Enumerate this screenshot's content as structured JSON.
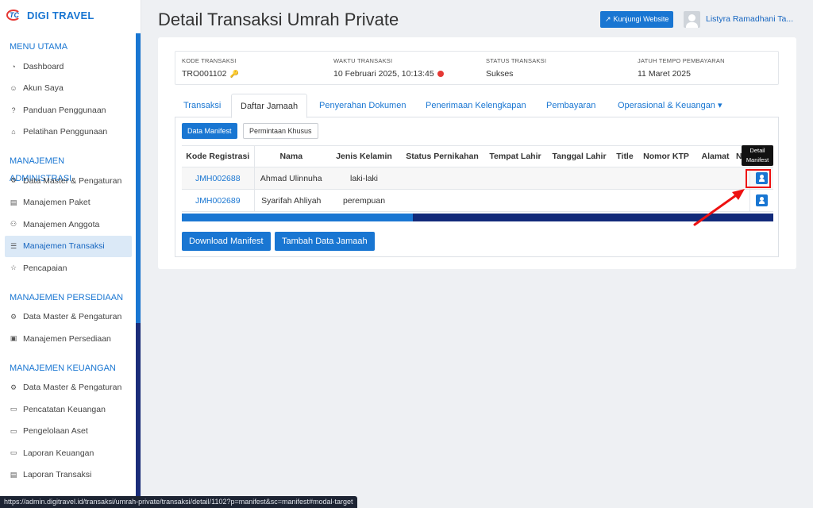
{
  "brand": {
    "name": "DIGI TRAVEL",
    "logo_text": "TC"
  },
  "sidebar": {
    "sections": [
      {
        "title": "MENU UTAMA",
        "items": [
          {
            "label": "Dashboard",
            "icon": "dashboard-icon"
          },
          {
            "label": "Akun Saya",
            "icon": "user-icon"
          },
          {
            "label": "Panduan Penggunaan",
            "icon": "question-icon"
          },
          {
            "label": "Pelatihan Penggunaan",
            "icon": "graduation-cap-icon"
          }
        ]
      },
      {
        "title": "MANAJEMEN ADMINISTRASI",
        "items": [
          {
            "label": "Data Master & Pengaturan",
            "icon": "cogs-icon"
          },
          {
            "label": "Manajemen Paket",
            "icon": "book-icon"
          },
          {
            "label": "Manajemen Anggota",
            "icon": "users-icon"
          },
          {
            "label": "Manajemen Transaksi",
            "icon": "cart-icon",
            "active": true
          },
          {
            "label": "Pencapaian",
            "icon": "star-icon"
          }
        ]
      },
      {
        "title": "MANAJEMEN PERSEDIAAN",
        "items": [
          {
            "label": "Data Master & Pengaturan",
            "icon": "cogs-icon"
          },
          {
            "label": "Manajemen Persediaan",
            "icon": "cubes-icon"
          }
        ]
      },
      {
        "title": "MANAJEMEN KEUANGAN",
        "items": [
          {
            "label": "Data Master & Pengaturan",
            "icon": "cogs-icon"
          },
          {
            "label": "Pencatatan Keuangan",
            "icon": "money-icon"
          },
          {
            "label": "Pengelolaan Aset",
            "icon": "inbox-icon"
          },
          {
            "label": "Laporan Keuangan",
            "icon": "money-icon"
          },
          {
            "label": "Laporan Transaksi",
            "icon": "book-icon"
          }
        ]
      }
    ]
  },
  "header": {
    "title": "Detail Transaksi Umrah Private",
    "visit_button": "Kunjungi Website",
    "username": "Listyra Ramadhani Ta..."
  },
  "info": {
    "code_label": "KODE TRANSAKSI",
    "code_value": "TRO001102",
    "time_label": "WAKTU TRANSAKSI",
    "time_value": "10 Februari 2025, 10:13:45",
    "status_label": "STATUS TRANSAKSI",
    "status_value": "Sukses",
    "due_label": "JATUH TEMPO PEMBAYARAN",
    "due_value": "11 Maret 2025"
  },
  "tabs": [
    "Transaksi",
    "Daftar Jamaah",
    "Penyerahan Dokumen",
    "Penerimaan Kelengkapan",
    "Pembayaran",
    "Operasional & Keuangan"
  ],
  "subtabs": {
    "manifest": "Data Manifest",
    "special": "Permintaan Khusus"
  },
  "table": {
    "headers": [
      "Kode Registrasi",
      "Nama",
      "Jenis Kelamin",
      "Status Pernikahan",
      "Tempat Lahir",
      "Tanggal Lahir",
      "Title",
      "Nomor KTP",
      "Alamat",
      "No"
    ],
    "rows": [
      {
        "code": "JMH002688",
        "name": "Ahmad Ulinnuha",
        "gender": "laki-laki"
      },
      {
        "code": "JMH002689",
        "name": "Syarifah Ahliyah",
        "gender": "perempuan"
      }
    ],
    "scroll_fraction": 0.39
  },
  "buttons": {
    "download": "Download Manifest",
    "add": "Tambah Data Jamaah"
  },
  "tooltip": {
    "line1": "Detail",
    "line2": "Manifest"
  },
  "statusbar": "https://admin.digitravel.id/transaksi/umrah-private/transaksi/detail/1102?p=manifest&sc=manifest#modal-target",
  "colors": {
    "primary": "#1976d2",
    "highlight": "#e11111",
    "sidebar_scroll": "#1b2d7a"
  }
}
